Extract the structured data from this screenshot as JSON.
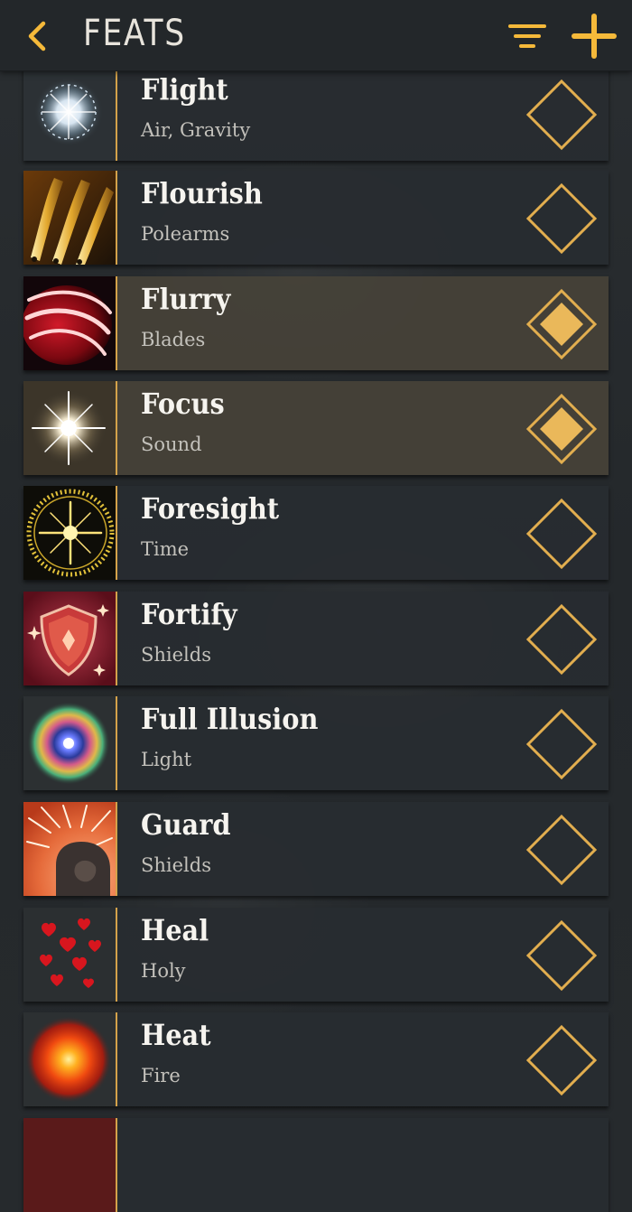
{
  "header": {
    "title": "FEATS",
    "back_icon": "chevron-left-icon",
    "filter_icon": "filter-icon",
    "add_icon": "plus-icon",
    "accent_color": "#f5b93a"
  },
  "feats": [
    {
      "name": "Flight",
      "category": "Air, Gravity",
      "icon": "white-energy-orb-icon",
      "selected": false
    },
    {
      "name": "Flourish",
      "category": "Polearms",
      "icon": "golden-blades-icon",
      "selected": false
    },
    {
      "name": "Flurry",
      "category": "Blades",
      "icon": "red-slash-icon",
      "selected": true
    },
    {
      "name": "Focus",
      "category": "Sound",
      "icon": "white-starburst-icon",
      "selected": true
    },
    {
      "name": "Foresight",
      "category": "Time",
      "icon": "golden-rune-circle-icon",
      "selected": false
    },
    {
      "name": "Fortify",
      "category": "Shields",
      "icon": "red-shield-icon",
      "selected": false
    },
    {
      "name": "Full Illusion",
      "category": "Light",
      "icon": "rainbow-orb-icon",
      "selected": false
    },
    {
      "name": "Guard",
      "category": "Shields",
      "icon": "arrow-barrage-icon",
      "selected": false
    },
    {
      "name": "Heal",
      "category": "Holy",
      "icon": "red-hearts-icon",
      "selected": false
    },
    {
      "name": "Heat",
      "category": "Fire",
      "icon": "fire-orb-icon",
      "selected": false
    }
  ]
}
